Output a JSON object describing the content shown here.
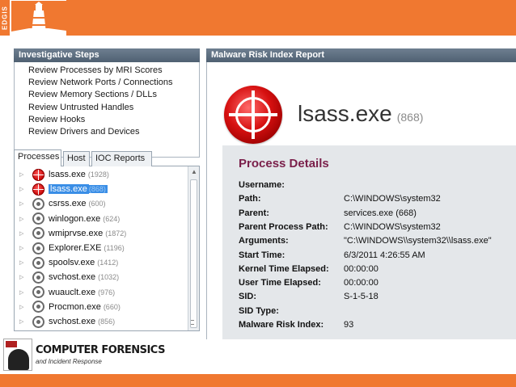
{
  "brand": {
    "side_text": "EDGIS",
    "accent_color": "#f07830"
  },
  "left_panel": {
    "header": "Investigative Steps",
    "steps": [
      "Review Processes by MRI Scores",
      "Review Network Ports / Connections",
      "Review Memory Sections / DLLs",
      "Review Untrusted Handles",
      "Review Hooks",
      "Review Drivers and Devices"
    ],
    "tabs": [
      "Processes",
      "Host",
      "IOC Reports"
    ],
    "processes": [
      {
        "name": "lsass.exe",
        "pid": "(1928)",
        "icon": "red-target-icon"
      },
      {
        "name": "lsass.exe",
        "pid": "(868)",
        "icon": "red-target-icon",
        "selected": true
      },
      {
        "name": "csrss.exe",
        "pid": "(600)",
        "icon": "gray-process-icon"
      },
      {
        "name": "winlogon.exe",
        "pid": "(624)",
        "icon": "gray-process-icon"
      },
      {
        "name": "wmiprvse.exe",
        "pid": "(1872)",
        "icon": "gray-process-icon"
      },
      {
        "name": "Explorer.EXE",
        "pid": "(1196)",
        "icon": "gray-process-icon"
      },
      {
        "name": "spoolsv.exe",
        "pid": "(1412)",
        "icon": "gray-process-icon"
      },
      {
        "name": "svchost.exe",
        "pid": "(1032)",
        "icon": "gray-process-icon"
      },
      {
        "name": "wuauclt.exe",
        "pid": "(976)",
        "icon": "gray-process-icon"
      },
      {
        "name": "Procmon.exe",
        "pid": "(660)",
        "icon": "gray-process-icon"
      },
      {
        "name": "svchost.exe",
        "pid": "(856)",
        "icon": "gray-process-icon"
      }
    ]
  },
  "right_panel": {
    "header": "Malware Risk Index Report",
    "process_name": "lsass.exe",
    "process_pid": "(868)",
    "details_title": "Process Details",
    "details": [
      {
        "label": "Username:",
        "value": ""
      },
      {
        "label": "Path:",
        "value": "C:\\WINDOWS\\system32"
      },
      {
        "label": "Parent:",
        "value": "services.exe (668)"
      },
      {
        "label": "Parent Process Path:",
        "value": "C:\\WINDOWS\\system32"
      },
      {
        "label": "Arguments:",
        "value": "\"C:\\WINDOWS\\\\system32\\\\lsass.exe\""
      },
      {
        "label": "Start Time:",
        "value": "6/3/2011 4:26:55 AM"
      },
      {
        "label": "Kernel Time Elapsed:",
        "value": "00:00:00"
      },
      {
        "label": "User Time Elapsed:",
        "value": "00:00:00"
      },
      {
        "label": "SID:",
        "value": "S-1-5-18"
      },
      {
        "label": "SID Type:",
        "value": ""
      },
      {
        "label": "Malware Risk Index:",
        "value": "93"
      }
    ]
  },
  "footer": {
    "title": "COMPUTER FORENSICS",
    "subtitle": "and Incident Response"
  }
}
